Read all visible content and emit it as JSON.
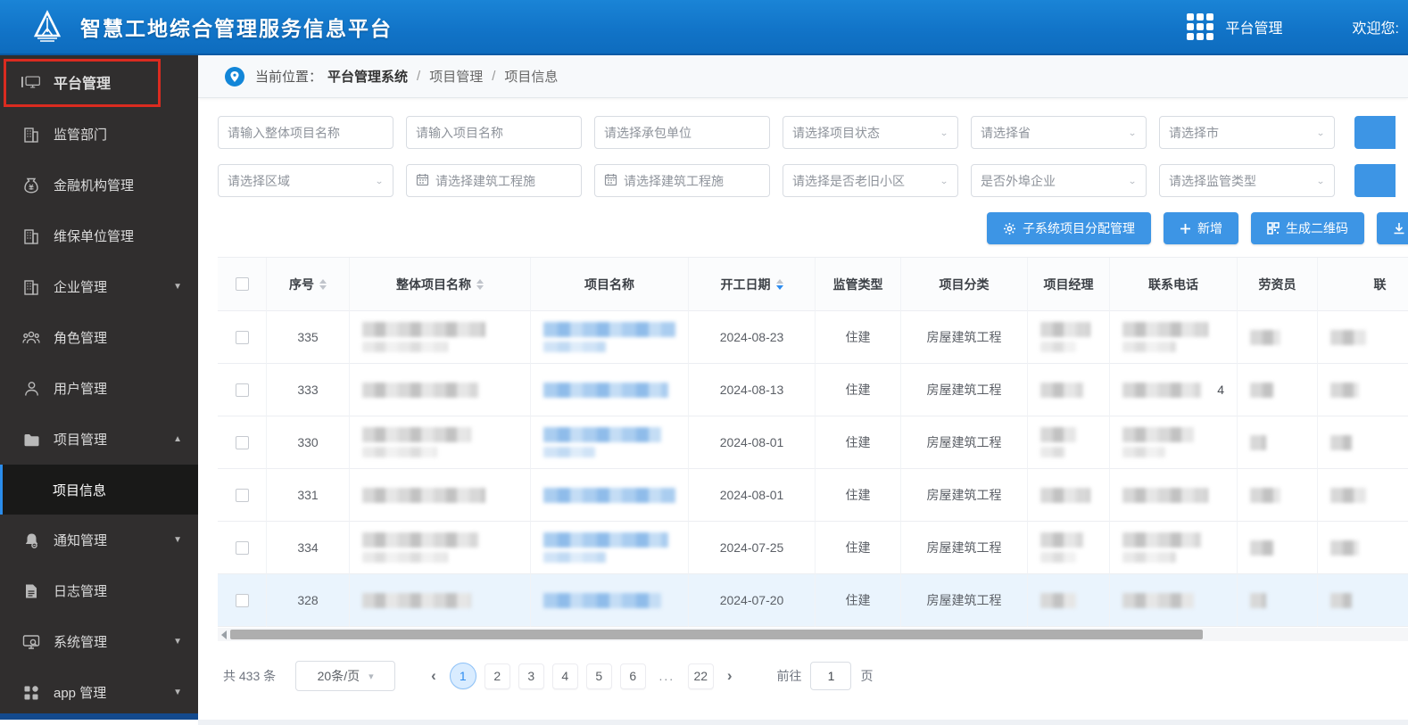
{
  "header": {
    "title": "智慧工地综合管理服务信息平台",
    "nav_label": "平台管理",
    "welcome": "欢迎您:",
    "accent_color": "#1173c7"
  },
  "sidebar": {
    "items": [
      {
        "label": "平台管理",
        "icon": "platform-monitor-icon",
        "top": true,
        "annotated_red_box": true
      },
      {
        "label": "监管部门",
        "icon": "building-icon"
      },
      {
        "label": "金融机构管理",
        "icon": "moneybag-icon"
      },
      {
        "label": "维保单位管理",
        "icon": "building-icon"
      },
      {
        "label": "企业管理",
        "icon": "building-icon",
        "arrow": "down"
      },
      {
        "label": "角色管理",
        "icon": "team-icon"
      },
      {
        "label": "用户管理",
        "icon": "user-icon"
      },
      {
        "label": "项目管理",
        "icon": "folder-icon",
        "arrow": "up"
      },
      {
        "label": "项目信息",
        "sub": true,
        "active": true
      },
      {
        "label": "通知管理",
        "icon": "bell-icon",
        "arrow": "down"
      },
      {
        "label": "日志管理",
        "icon": "log-icon"
      },
      {
        "label": "系统管理",
        "icon": "system-icon",
        "arrow": "down"
      },
      {
        "label": "app 管理",
        "icon": "app-icon",
        "arrow": "down"
      }
    ]
  },
  "breadcrumb": {
    "prefix": "当前位置：",
    "root": "平台管理系统",
    "separator": "/",
    "items": [
      "项目管理",
      "项目信息"
    ]
  },
  "filters": {
    "row1": [
      {
        "placeholder": "请输入整体项目名称",
        "type": "text"
      },
      {
        "placeholder": "请输入项目名称",
        "type": "text"
      },
      {
        "placeholder": "请选择承包单位",
        "type": "text"
      },
      {
        "placeholder": "请选择项目状态",
        "type": "select"
      },
      {
        "placeholder": "请选择省",
        "type": "select"
      },
      {
        "placeholder": "请选择市",
        "type": "select"
      }
    ],
    "row2": [
      {
        "placeholder": "请选择区域",
        "type": "select"
      },
      {
        "placeholder": "请选择建筑工程施",
        "type": "date"
      },
      {
        "placeholder": "请选择建筑工程施",
        "type": "date"
      },
      {
        "placeholder": "请选择是否老旧小区",
        "type": "select"
      },
      {
        "placeholder": "是否外埠企业",
        "type": "select"
      },
      {
        "placeholder": "请选择监管类型",
        "type": "select"
      }
    ]
  },
  "toolbar": {
    "buttons": [
      {
        "label": "子系统项目分配管理",
        "icon": "gear-icon"
      },
      {
        "label": "新增",
        "icon": "plus-icon"
      },
      {
        "label": "生成二维码",
        "icon": "qrcode-icon"
      },
      {
        "label": "下载",
        "icon": "download-icon",
        "clipped": true
      }
    ]
  },
  "table": {
    "columns": [
      {
        "label": "",
        "type": "checkbox"
      },
      {
        "label": "序号",
        "sortable": true
      },
      {
        "label": "整体项目名称",
        "sortable": true
      },
      {
        "label": "项目名称"
      },
      {
        "label": "开工日期",
        "sortable": true,
        "sorted": "desc"
      },
      {
        "label": "监管类型"
      },
      {
        "label": "项目分类"
      },
      {
        "label": "项目经理"
      },
      {
        "label": "联系电话"
      },
      {
        "label": "劳资员"
      },
      {
        "label": "联",
        "clipped": true
      }
    ],
    "rows": [
      {
        "seq": "335",
        "start_date": "2024-08-23",
        "supervision": "住建",
        "category": "房屋建筑工程",
        "phone_extra": ""
      },
      {
        "seq": "333",
        "start_date": "2024-08-13",
        "supervision": "住建",
        "category": "房屋建筑工程",
        "phone_extra": "4"
      },
      {
        "seq": "330",
        "start_date": "2024-08-01",
        "supervision": "住建",
        "category": "房屋建筑工程",
        "phone_extra": ""
      },
      {
        "seq": "331",
        "start_date": "2024-08-01",
        "supervision": "住建",
        "category": "房屋建筑工程",
        "phone_extra": ""
      },
      {
        "seq": "334",
        "start_date": "2024-07-25",
        "supervision": "住建",
        "category": "房屋建筑工程",
        "phone_extra": ""
      },
      {
        "seq": "328",
        "start_date": "2024-07-20",
        "supervision": "住建",
        "category": "房屋建筑工程",
        "phone_extra": "",
        "highlighted": true
      }
    ],
    "redacted_columns": [
      "整体项目名称",
      "项目名称",
      "项目经理",
      "联系电话",
      "劳资员",
      "联"
    ]
  },
  "pagination": {
    "total_text": "共 433 条",
    "page_size_label": "20条/页",
    "pages": [
      "1",
      "2",
      "3",
      "4",
      "5",
      "6",
      "...",
      "22"
    ],
    "active_page": "1",
    "goto_prefix": "前往",
    "goto_value": "1",
    "goto_suffix": "页"
  }
}
